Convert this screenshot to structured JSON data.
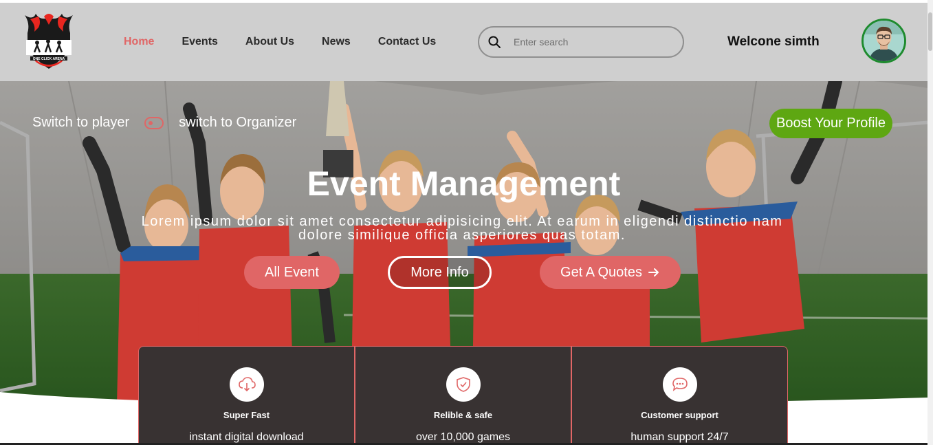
{
  "brand": {
    "name": "ONE CLICK ARENA",
    "accent": "#e06666",
    "header_bg": "#cfcfcf",
    "boost_color": "#5ea712"
  },
  "nav": {
    "items": [
      {
        "label": "Home",
        "active": true
      },
      {
        "label": "Events",
        "active": false
      },
      {
        "label": "About Us",
        "active": false
      },
      {
        "label": "News",
        "active": false
      },
      {
        "label": "Contact Us",
        "active": false
      }
    ]
  },
  "search": {
    "placeholder": "Enter search",
    "value": "",
    "icon": "search-icon"
  },
  "user": {
    "welcome": "Welcone simth",
    "avatar": "user-avatar"
  },
  "hero": {
    "switch_left": "Switch to player",
    "switch_right": "switch to Organizer",
    "boost": "Boost Your Profile",
    "title": "Event Management",
    "text": "Lorem ipsum dolor sit amet consectetur adipisicing elit. At earum in eligendi distinctio nam dolore similique officia asperiores quas totam.",
    "buttons": {
      "all_event": "All Event",
      "more_info": "More Info",
      "get_quotes": "Get A Quotes"
    }
  },
  "features": [
    {
      "title": "Super Fast",
      "sub": "instant digital download",
      "icon": "cloud-download-icon"
    },
    {
      "title": "Relible & safe",
      "sub": "over 10,000 games",
      "icon": "shield-check-icon"
    },
    {
      "title": "Customer support",
      "sub": "human support 24/7",
      "icon": "chat-bubble-icon"
    }
  ]
}
